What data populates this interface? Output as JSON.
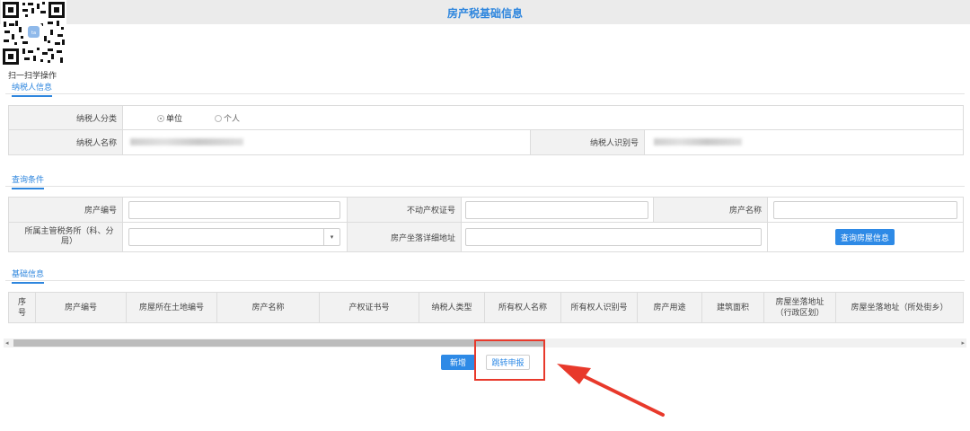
{
  "page": {
    "title": "房产税基础信息"
  },
  "qr": {
    "caption": "扫一扫学操作"
  },
  "taxpayer": {
    "section_label": "纳税人信息",
    "category_label": "纳税人分类",
    "category_options": [
      "单位",
      "个人"
    ],
    "category_selected": "单位",
    "name_label": "纳税人名称",
    "id_label": "纳税人识别号"
  },
  "query": {
    "section_label": "查询条件",
    "property_no_label": "房产编号",
    "real_estate_cert_label": "不动产权证号",
    "property_name_label": "房产名称",
    "tax_office_label": "所属主管税务所（科、分局）",
    "address_label": "房产坐落详细地址",
    "search_button": "查询房屋信息"
  },
  "basic": {
    "section_label": "基础信息",
    "columns": [
      "序号",
      "房产编号",
      "房屋所在土地编号",
      "房产名称",
      "产权证书号",
      "纳税人类型",
      "所有权人名称",
      "所有权人识别号",
      "房产用途",
      "建筑面积",
      "房屋坐落地址（行政区划）",
      "房屋坐落地址（所处街乡）"
    ]
  },
  "actions": {
    "add_button": "新增",
    "jump_button": "跳转申报"
  },
  "colors": {
    "accent": "#2e8ae6",
    "highlight": "#e8392b"
  }
}
